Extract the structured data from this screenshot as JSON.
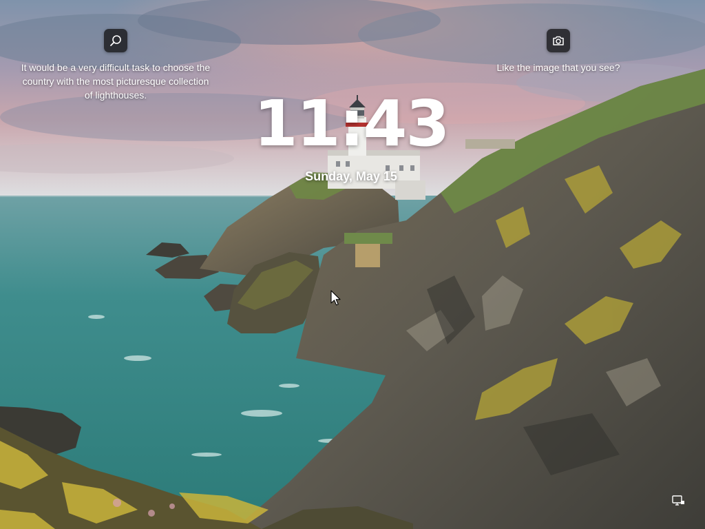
{
  "lockscreen": {
    "time": "11:43",
    "date": "Sunday, May 15",
    "spotlight_fact": "It would be a very difficult task to choose the country with the most picturesque collection of lighthouses.",
    "like_prompt": "Like the image that you see?"
  },
  "icons": {
    "search": "search-icon",
    "camera": "camera-icon",
    "network": "network-icon",
    "cursor": "mouse-pointer"
  },
  "colors": {
    "sky_top": "#8a9fb6",
    "sky_pink": "#d9a3a8",
    "sea": "#3e8f8c",
    "cliff": "#5f5a4f",
    "moss": "#b9a83a",
    "button_bg": "#141416"
  }
}
